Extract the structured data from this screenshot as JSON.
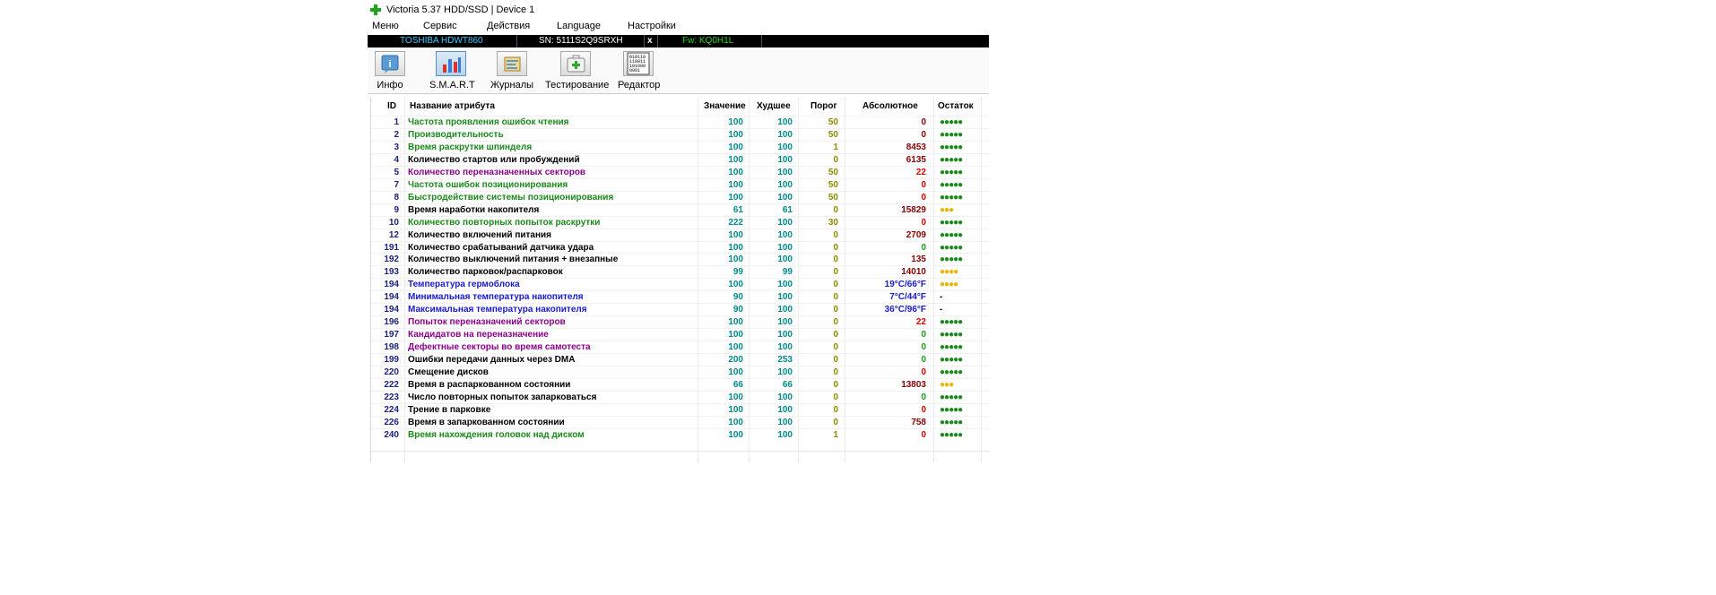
{
  "window": {
    "title": "Victoria 5.37 HDD/SSD | Device 1"
  },
  "menu": [
    "Меню",
    "Сервис",
    "Действия",
    "Language",
    "Настройки"
  ],
  "device": {
    "model": "TOSHIBA HDWT860",
    "serial": "SN: 5111S2Q9SRXH",
    "close": "x",
    "firmware": "Fw: KQ0H1L",
    "colors": {
      "model": "#3ec8ff",
      "serial": "#ffffff",
      "firmware": "#29d629"
    }
  },
  "toolbar": {
    "tools": [
      {
        "label": "Инфо",
        "icon": "info-icon",
        "active": false
      },
      {
        "label": "S.M.A.R.T",
        "icon": "smart-chart-icon",
        "active": true
      },
      {
        "label": "Журналы",
        "icon": "journal-icon",
        "active": false
      },
      {
        "label": "Тестирование",
        "icon": "medkit-icon",
        "active": false
      },
      {
        "label": "Редактор",
        "icon": "binary-editor-icon",
        "active": false
      }
    ],
    "editor_icon_text": [
      "010110",
      "110011",
      "101000",
      "0001"
    ]
  },
  "table": {
    "headers": {
      "id": "ID",
      "name": "Название атрибута",
      "value": "Значение",
      "worst": "Худшее",
      "threshold": "Порог",
      "raw": "Абсолютное",
      "health": "Остаток"
    },
    "status_colors": {
      "green": "#1a8a1a",
      "black": "#000000",
      "purple": "#8b008b",
      "blue": "#1a1acc",
      "abs_dark": "#8b0000",
      "abs_red": "#e00000",
      "abs_green": "#1a9a1a",
      "dots_green": "#1a8a1a",
      "dots_yellow": "#f0b400"
    },
    "rows": [
      {
        "id": "1",
        "name": "Частота проявления ошибок чтения",
        "value": "100",
        "worst": "100",
        "threshold": "50",
        "raw": "0",
        "health": "●●●●●",
        "name_color": "green",
        "raw_color": "abs_dark",
        "health_color": "dots_green"
      },
      {
        "id": "2",
        "name": "Производительность",
        "value": "100",
        "worst": "100",
        "threshold": "50",
        "raw": "0",
        "health": "●●●●●",
        "name_color": "green",
        "raw_color": "abs_dark",
        "health_color": "dots_green"
      },
      {
        "id": "3",
        "name": "Время раскрутки шпинделя",
        "value": "100",
        "worst": "100",
        "threshold": "1",
        "raw": "8453",
        "health": "●●●●●",
        "name_color": "green",
        "raw_color": "abs_dark",
        "health_color": "dots_green"
      },
      {
        "id": "4",
        "name": "Количество стартов или пробуждений",
        "value": "100",
        "worst": "100",
        "threshold": "0",
        "raw": "6135",
        "health": "●●●●●",
        "name_color": "black",
        "raw_color": "abs_dark",
        "health_color": "dots_green"
      },
      {
        "id": "5",
        "name": "Количество переназначенных секторов",
        "value": "100",
        "worst": "100",
        "threshold": "50",
        "raw": "22",
        "health": "●●●●●",
        "name_color": "purple",
        "raw_color": "abs_red",
        "health_color": "dots_green"
      },
      {
        "id": "7",
        "name": "Частота ошибок позиционирования",
        "value": "100",
        "worst": "100",
        "threshold": "50",
        "raw": "0",
        "health": "●●●●●",
        "name_color": "green",
        "raw_color": "abs_red",
        "health_color": "dots_green"
      },
      {
        "id": "8",
        "name": "Быстродействие системы позиционирования",
        "value": "100",
        "worst": "100",
        "threshold": "50",
        "raw": "0",
        "health": "●●●●●",
        "name_color": "green",
        "raw_color": "abs_red",
        "health_color": "dots_green"
      },
      {
        "id": "9",
        "name": "Время наработки накопителя",
        "value": "61",
        "worst": "61",
        "threshold": "0",
        "raw": "15829",
        "health": "●●●",
        "name_color": "black",
        "raw_color": "abs_dark",
        "health_color": "dots_yellow"
      },
      {
        "id": "10",
        "name": "Количество повторных попыток раскрутки",
        "value": "222",
        "worst": "100",
        "threshold": "30",
        "raw": "0",
        "health": "●●●●●",
        "name_color": "green",
        "raw_color": "abs_red",
        "health_color": "dots_green"
      },
      {
        "id": "12",
        "name": "Количество включений питания",
        "value": "100",
        "worst": "100",
        "threshold": "0",
        "raw": "2709",
        "health": "●●●●●",
        "name_color": "black",
        "raw_color": "abs_dark",
        "health_color": "dots_green"
      },
      {
        "id": "191",
        "name": "Количество срабатываний датчика удара",
        "value": "100",
        "worst": "100",
        "threshold": "0",
        "raw": "0",
        "health": "●●●●●",
        "name_color": "black",
        "raw_color": "abs_green",
        "health_color": "dots_green"
      },
      {
        "id": "192",
        "name": "Количество выключений питания + внезапные",
        "value": "100",
        "worst": "100",
        "threshold": "0",
        "raw": "135",
        "health": "●●●●●",
        "name_color": "black",
        "raw_color": "abs_dark",
        "health_color": "dots_green"
      },
      {
        "id": "193",
        "name": "Количество парковок/распарковок",
        "value": "99",
        "worst": "99",
        "threshold": "0",
        "raw": "14010",
        "health": "●●●●",
        "name_color": "black",
        "raw_color": "abs_dark",
        "health_color": "dots_yellow"
      },
      {
        "id": "194",
        "name": "Температура гермоблока",
        "value": "100",
        "worst": "100",
        "threshold": "0",
        "raw": "19°C/66°F",
        "health": "●●●●",
        "name_color": "blue",
        "raw_color": "blue",
        "health_color": "dots_yellow"
      },
      {
        "id": "194",
        "name": "Минимальная температура накопителя",
        "value": "90",
        "worst": "100",
        "threshold": "0",
        "raw": "7°C/44°F",
        "health": "-",
        "name_color": "blue",
        "raw_color": "blue",
        "health_color": "black"
      },
      {
        "id": "194",
        "name": "Максимальная температура накопителя",
        "value": "90",
        "worst": "100",
        "threshold": "0",
        "raw": "36°C/96°F",
        "health": "-",
        "name_color": "blue",
        "raw_color": "blue",
        "health_color": "black"
      },
      {
        "id": "196",
        "name": "Попыток переназначений секторов",
        "value": "100",
        "worst": "100",
        "threshold": "0",
        "raw": "22",
        "health": "●●●●●",
        "name_color": "purple",
        "raw_color": "abs_red",
        "health_color": "dots_green"
      },
      {
        "id": "197",
        "name": "Кандидатов на переназначение",
        "value": "100",
        "worst": "100",
        "threshold": "0",
        "raw": "0",
        "health": "●●●●●",
        "name_color": "purple",
        "raw_color": "abs_green",
        "health_color": "dots_green"
      },
      {
        "id": "198",
        "name": "Дефектные секторы во время самотеста",
        "value": "100",
        "worst": "100",
        "threshold": "0",
        "raw": "0",
        "health": "●●●●●",
        "name_color": "purple",
        "raw_color": "abs_green",
        "health_color": "dots_green"
      },
      {
        "id": "199",
        "name": "Ошибки передачи данных через DMA",
        "value": "200",
        "worst": "253",
        "threshold": "0",
        "raw": "0",
        "health": "●●●●●",
        "name_color": "black",
        "raw_color": "abs_green",
        "health_color": "dots_green"
      },
      {
        "id": "220",
        "name": "Смещение дисков",
        "value": "100",
        "worst": "100",
        "threshold": "0",
        "raw": "0",
        "health": "●●●●●",
        "name_color": "black",
        "raw_color": "abs_red",
        "health_color": "dots_green"
      },
      {
        "id": "222",
        "name": "Время в распаркованном состоянии",
        "value": "66",
        "worst": "66",
        "threshold": "0",
        "raw": "13803",
        "health": "●●●",
        "name_color": "black",
        "raw_color": "abs_dark",
        "health_color": "dots_yellow"
      },
      {
        "id": "223",
        "name": "Число повторных попыток запарковаться",
        "value": "100",
        "worst": "100",
        "threshold": "0",
        "raw": "0",
        "health": "●●●●●",
        "name_color": "black",
        "raw_color": "abs_green",
        "health_color": "dots_green"
      },
      {
        "id": "224",
        "name": "Трение в парковке",
        "value": "100",
        "worst": "100",
        "threshold": "0",
        "raw": "0",
        "health": "●●●●●",
        "name_color": "black",
        "raw_color": "abs_red",
        "health_color": "dots_green"
      },
      {
        "id": "226",
        "name": "Время в запаркованном состоянии",
        "value": "100",
        "worst": "100",
        "threshold": "0",
        "raw": "758",
        "health": "●●●●●",
        "name_color": "black",
        "raw_color": "abs_dark",
        "health_color": "dots_green"
      },
      {
        "id": "240",
        "name": "Время нахождения головок над диском",
        "value": "100",
        "worst": "100",
        "threshold": "1",
        "raw": "0",
        "health": "●●●●●",
        "name_color": "green",
        "raw_color": "abs_red",
        "health_color": "dots_green"
      }
    ]
  }
}
